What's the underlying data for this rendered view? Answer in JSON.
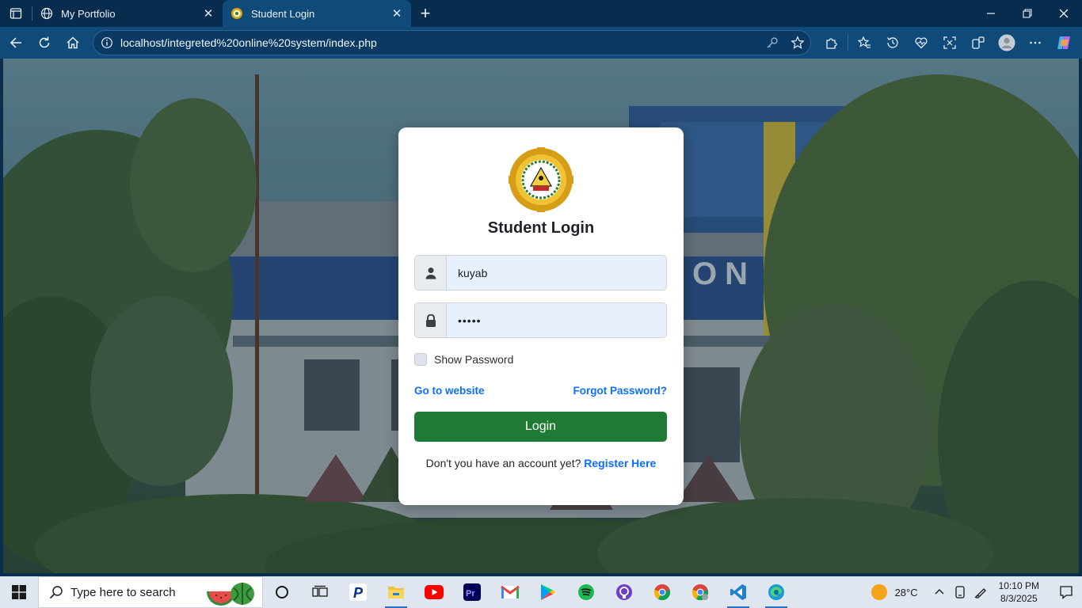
{
  "browser": {
    "tabs": [
      {
        "title": "My Portfolio",
        "icon": "globe-icon",
        "active": false
      },
      {
        "title": "Student Login",
        "icon": "school-logo-icon",
        "active": true
      }
    ],
    "address": "localhost/integreted%20online%20system/index.php"
  },
  "login": {
    "heading": "Student Login",
    "username_value": "kuyab",
    "password_value": "•••••",
    "show_password_label": "Show Password",
    "go_to_website": "Go to website",
    "forgot_password": "Forgot Password?",
    "login_button": "Login",
    "register_prompt": "Don't you have an account yet?",
    "register_link": "Register Here"
  },
  "taskbar": {
    "search_placeholder": "Type here to search",
    "temperature": "28°C",
    "time": "10:10 PM",
    "date": "8/3/2025",
    "apps": [
      "cortana-icon",
      "task-view-icon",
      "paypal-icon",
      "file-explorer-icon",
      "youtube-icon",
      "premiere-icon",
      "gmail-icon",
      "google-play-icon",
      "spotify-icon",
      "github-icon",
      "chrome-icon",
      "chrome-alt-icon",
      "vscode-icon",
      "edge-icon"
    ]
  },
  "colors": {
    "accent_blue": "#0d6efd",
    "login_green": "#1f7a33",
    "chrome_dark": "#082c4e",
    "chrome_tab": "#0f4a78"
  }
}
